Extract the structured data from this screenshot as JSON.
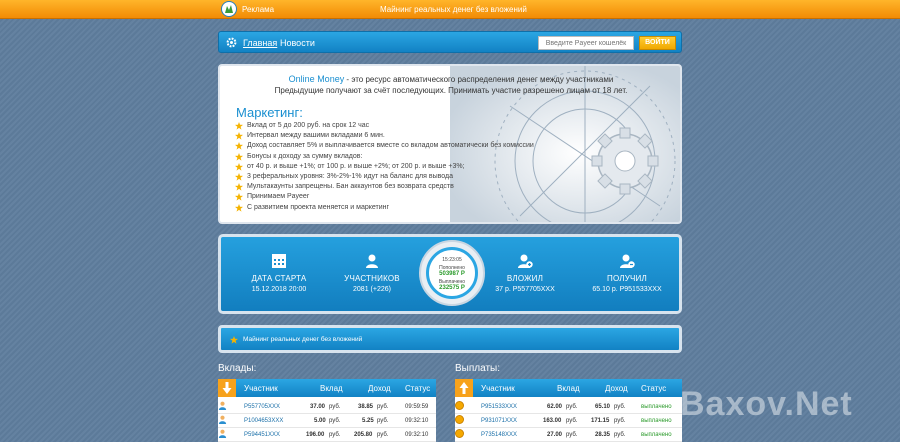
{
  "topbar": {
    "link": "Реклама",
    "marquee": "Майнинг реальных денег без вложений"
  },
  "nav": {
    "home": "Главная",
    "news": "Новости",
    "payeer_placeholder": "Введите Payeer кошелёк",
    "login": "ВОЙТИ"
  },
  "info": {
    "brand": "Online Money",
    "intro1": " - это ресурс автоматического распределения денег между участниками",
    "intro2": "Предыдущие получают за счёт последующих. Принимать участие разрешено лицам от 18 лет.",
    "marketing_title": "Маркетинг:",
    "items": [
      "Вклад от 5 до 200 руб. на срок 12 час",
      "Интервал между вашими вкладами 6 мин.",
      "Доход составляет 5% и выплачивается вместе со вкладом автоматически без комиссии",
      "Бонусы к доходу за сумму вкладов:",
      "от 40 р. и выше +1%; от 100 р. и выше +2%; от 200 р. и выше +3%;",
      "3 реферальных уровня: 3%-2%-1% идут на баланс для вывода",
      "Мультакаунты запрещены. Бан аккаунтов без возврата средств",
      "Принимаем Payeer",
      "С развитием проекта меняется и маркетинг"
    ]
  },
  "stats": {
    "start": {
      "label": "ДАТА СТАРТА",
      "value": "15.12.2018 20:00"
    },
    "users": {
      "label": "УЧАСТНИКОВ",
      "value": "2081 (+226)"
    },
    "clock": {
      "time": "15:23:05",
      "in_label": "Пополнено",
      "in_value": "503987 Р",
      "out_label": "Выплачено",
      "out_value": "232575 Р"
    },
    "deposit": {
      "label": "ВЛОЖИЛ",
      "value": "37 р. P557705XXX"
    },
    "received": {
      "label": "ПОЛУЧИЛ",
      "value": "65.10 р. P951533XXX"
    }
  },
  "marquee_bar": {
    "text": "Майнинг реальных денег без вложений"
  },
  "deposits": {
    "title": "Вклады:",
    "headers": {
      "user": "Участник",
      "amount": "Вклад",
      "income": "Доход",
      "status": "Статус"
    },
    "rows": [
      {
        "user": "P557705XXX",
        "amount": "37.00",
        "income": "38.85",
        "status": "09:59:59"
      },
      {
        "user": "P1004653XXX",
        "amount": "5.00",
        "income": "5.25",
        "status": "09:32:10"
      },
      {
        "user": "P594451XXX",
        "amount": "196.00",
        "income": "205.80",
        "status": "09:32:10"
      }
    ]
  },
  "payouts": {
    "title": "Выплаты:",
    "headers": {
      "user": "Участник",
      "amount": "Вклад",
      "income": "Доход",
      "status": "Статус"
    },
    "rows": [
      {
        "user": "P951533XXX",
        "amount": "62.00",
        "income": "65.10",
        "status": "выплачено"
      },
      {
        "user": "P931071XXX",
        "amount": "163.00",
        "income": "171.15",
        "status": "выплачено"
      },
      {
        "user": "P735148XXX",
        "amount": "27.00",
        "income": "28.35",
        "status": "выплачено"
      }
    ]
  },
  "currency": "руб.",
  "watermark": "Baxov.Net",
  "colors": {
    "orange": "#f28b05",
    "blue": "#1a8fd0",
    "green": "#2a9a2a"
  }
}
